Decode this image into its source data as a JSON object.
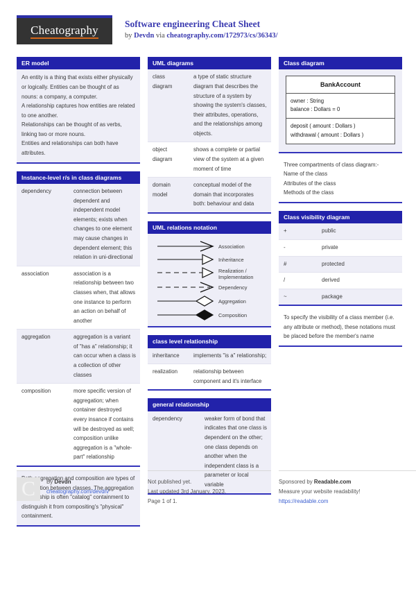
{
  "meta": {
    "logo_text": "Cheatography",
    "title": "Software engineering Cheat Sheet",
    "byline_prefix": "by ",
    "author": "Devdn",
    "byline_via": " via ",
    "source_url": "cheatography.com/172973/cs/36343/"
  },
  "colors": {
    "header_bar": "#2222aa",
    "accent_rule": "#3333bb",
    "title_blue": "#3b3bb0",
    "logo_bg": "#333333",
    "logo_underline": "#d4671a",
    "row_shade": "#eeeef7",
    "link": "#3b5fd0"
  },
  "blocks": {
    "er_model": {
      "title": "ER model",
      "text": "An entity is a thing that exists either physically or logically. Entities can be thought of as nouns: a company, a computer.\nA relationship captures how entities are related to one another.\nRelationships can be thought of as verbs, linking two or more nouns.\nEntities and relationships can both have attributes."
    },
    "instance_level": {
      "title": "Instance-level r/s in class diagrams",
      "rows": [
        {
          "term": "dependency",
          "definition": "connection between dependent and independent model elements; exists when changes to one element may cause changes in dependent element; this relation in uni-directional"
        },
        {
          "term": "association",
          "definition": "association is a relationship between two classes when, that allows one instance to perform an action on behalf of another"
        },
        {
          "term": "aggregation",
          "definition": "aggregation is a variant of \"has a\" relationship; it can occur when a class is a collection of other classes"
        },
        {
          "term": "composition",
          "definition": "more specific version of aggregation; when container destroyed every insance if contains will be destroyed as well; composition unlike aggregation is a \"whole-part\" relationship"
        }
      ],
      "note": "Both aggregation and composition are types of association between classes. The aggregation relationship is often \"catalog\" containment to distinguish it from composit­ing's \"physical\" containment."
    },
    "uml_diagrams": {
      "title": "UML diagrams",
      "rows": [
        {
          "term": "class diagram",
          "definition": "a type of static structure diagram that describes the structure of a system by showing the system's classes, their attributes, operat­ions, and the relationships among objects."
        },
        {
          "term": "object diagram",
          "definition": "shows a complete or partial view of the system at a given moment of time"
        },
        {
          "term": "domain model",
          "definition": "conceptual model of the domain that incorporates both: behaviour and data"
        }
      ]
    },
    "uml_relations": {
      "title": "UML relations notation",
      "items": [
        {
          "label": "Association",
          "line": "solid",
          "head": "open-arrow"
        },
        {
          "label": "Inheritance",
          "line": "solid",
          "head": "hollow-triangle"
        },
        {
          "label": "Realization / Implementation",
          "line": "dashed",
          "head": "hollow-triangle"
        },
        {
          "label": "Dependency",
          "line": "dashed",
          "head": "open-arrow"
        },
        {
          "label": "Aggregation",
          "line": "solid",
          "head": "hollow-diamond"
        },
        {
          "label": "Composition",
          "line": "solid",
          "head": "filled-diamond"
        }
      ]
    },
    "class_level": {
      "title": "class level relationship",
      "rows": [
        {
          "term": "inheri­tance",
          "definition": "implements \"is a\" relationship;"
        },
        {
          "term": "realiz­ation",
          "definition": "relationship between component and it's interface"
        }
      ]
    },
    "general_relationship": {
      "title": "general relationship",
      "rows": [
        {
          "term": "dependency",
          "definition": "weaker form of bond that indicates that one class is dependent on the other; one class depends on another when the independent class is a parameter or local variable"
        }
      ]
    },
    "class_diagram": {
      "title": "Class diagram",
      "uml": {
        "name": "BankAccount",
        "attributes": [
          "owner : String",
          "balance : Dollars = 0"
        ],
        "methods": [
          "deposit ( amount : Dollars )",
          "withdrawal ( amount : Dollars )"
        ]
      },
      "note": "Three compartments of class diagram:-\nName of the class\nAttributes of the class\nMethods of the class"
    },
    "class_visibility": {
      "title": "Class visibility diagram",
      "rows": [
        {
          "symbol": "+",
          "meaning": "public"
        },
        {
          "symbol": "-",
          "meaning": "private"
        },
        {
          "symbol": "#",
          "meaning": "protected"
        },
        {
          "symbol": "/",
          "meaning": "derived"
        },
        {
          "symbol": "~",
          "meaning": "package"
        }
      ],
      "note": "To specify the visibility of a class member (i.e. any attribute or method), these notations must be placed before the member's name"
    }
  },
  "footer": {
    "avatar_letter": "C",
    "by_label": "By ",
    "author": "Devdn",
    "author_url": "cheatography.com/devdn/",
    "publish_status": "Not published yet.",
    "last_updated": "Last updated 3rd January, 2023.",
    "page_number": "Page 1 of 1.",
    "sponsor_prefix": "Sponsored by ",
    "sponsor_name": "Readable.com",
    "sponsor_tagline": "Measure your website readability!",
    "sponsor_url": "https://readable.com"
  }
}
